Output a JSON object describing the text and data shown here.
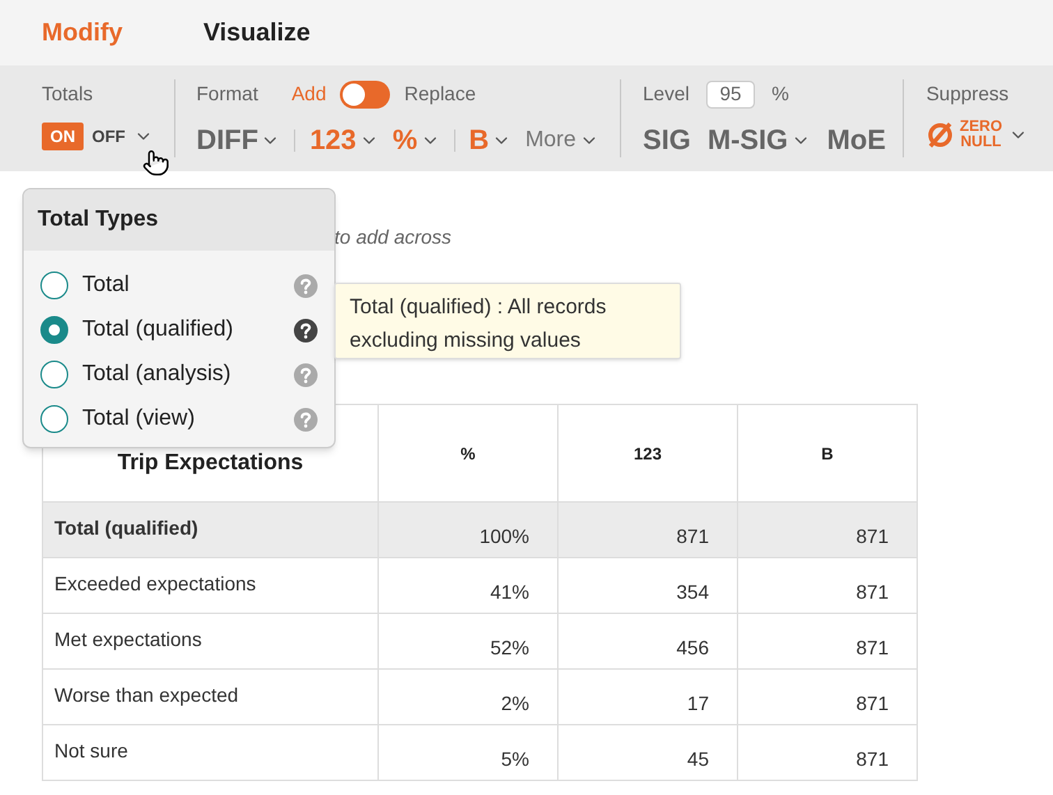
{
  "tabs": [
    {
      "label": "Modify",
      "selected": true
    },
    {
      "label": "Visualize",
      "selected": false
    }
  ],
  "totals": {
    "label": "Totals",
    "on_label": "ON",
    "off_label": "OFF",
    "on": true
  },
  "format": {
    "label": "Format",
    "add_label": "Add",
    "replace_label": "Replace",
    "replace": false,
    "buttons": [
      {
        "label": "DIFF",
        "active": false,
        "separator_before": false,
        "kind": "big"
      },
      {
        "label": "123",
        "active": true,
        "separator_before": true,
        "kind": "big"
      },
      {
        "label": "%",
        "active": true,
        "separator_before": false,
        "kind": "big"
      },
      {
        "label": "B",
        "active": true,
        "separator_before": true,
        "kind": "big"
      },
      {
        "label": "More",
        "active": false,
        "separator_before": false,
        "kind": "text"
      }
    ]
  },
  "level": {
    "label": "Level",
    "value": "95",
    "unit": "%",
    "buttons": [
      {
        "label": "SIG",
        "dropdown": false
      },
      {
        "label": "M-SIG",
        "dropdown": true
      },
      {
        "label": "MoE",
        "dropdown": false
      }
    ]
  },
  "suppress": {
    "label": "Suppress",
    "top": "ZERO",
    "bottom": "NULL"
  },
  "hint": "to add across",
  "popover": {
    "title": "Total Types",
    "items": [
      {
        "label": "Total",
        "selected": false
      },
      {
        "label": "Total (qualified)",
        "selected": true
      },
      {
        "label": "Total (analysis)",
        "selected": false
      },
      {
        "label": "Total (view)",
        "selected": false
      }
    ]
  },
  "tooltip": "Total (qualified) : All records excluding missing values",
  "table": {
    "columns": [
      "Trip Expectations",
      "%",
      "123",
      "B"
    ],
    "rows": [
      {
        "highlighted": true,
        "cells": [
          "Total (qualified)",
          "100%",
          "871",
          "871"
        ]
      },
      {
        "highlighted": false,
        "cells": [
          "Exceeded expectations",
          "41%",
          "354",
          "871"
        ]
      },
      {
        "highlighted": false,
        "cells": [
          "Met expectations",
          "52%",
          "456",
          "871"
        ]
      },
      {
        "highlighted": false,
        "cells": [
          "Worse than expected",
          "2%",
          "17",
          "871"
        ]
      },
      {
        "highlighted": false,
        "cells": [
          "Not sure",
          "5%",
          "45",
          "871"
        ]
      }
    ]
  }
}
